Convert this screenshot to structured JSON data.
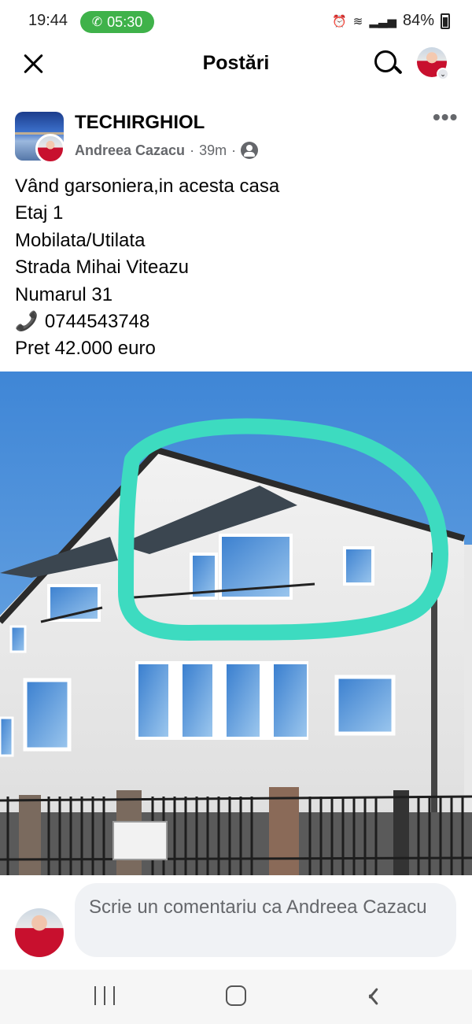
{
  "status_bar": {
    "time": "19:44",
    "call_timer": "05:30",
    "battery": "84%",
    "icons": [
      "phone-call-icon",
      "alarm-icon",
      "wifi-calling-icon",
      "vowifi-icon",
      "signal-icon",
      "battery-icon"
    ]
  },
  "header": {
    "title": "Postări",
    "icons": [
      "close-icon",
      "search-icon",
      "profile-avatar"
    ]
  },
  "post": {
    "group_name": "TECHIRGHIOL",
    "author": "Andreea Cazacu",
    "separator": "·",
    "time": "39m",
    "audience_icon": "members-icon",
    "more_icon": "more-options-icon",
    "lines": [
      "Vând garsoniera,in acesta casa",
      "Etaj 1",
      "Mobilata/Utilata",
      "Strada Mihai Viteazu",
      "Numarul 31"
    ],
    "phone": "0744543748",
    "price_line": "Pret 42.000 euro",
    "photo_description_icon": "house-photo",
    "highlight_color": "#3ddbc0"
  },
  "comment": {
    "placeholder": "Scrie un comentariu ca Andreea Cazacu"
  },
  "nav_bar": {
    "icons": [
      "recents-icon",
      "home-icon",
      "back-icon"
    ]
  },
  "colors": {
    "call_pill": "#3fb24a",
    "secondary_text": "#65676b",
    "input_background": "#f0f2f5"
  }
}
